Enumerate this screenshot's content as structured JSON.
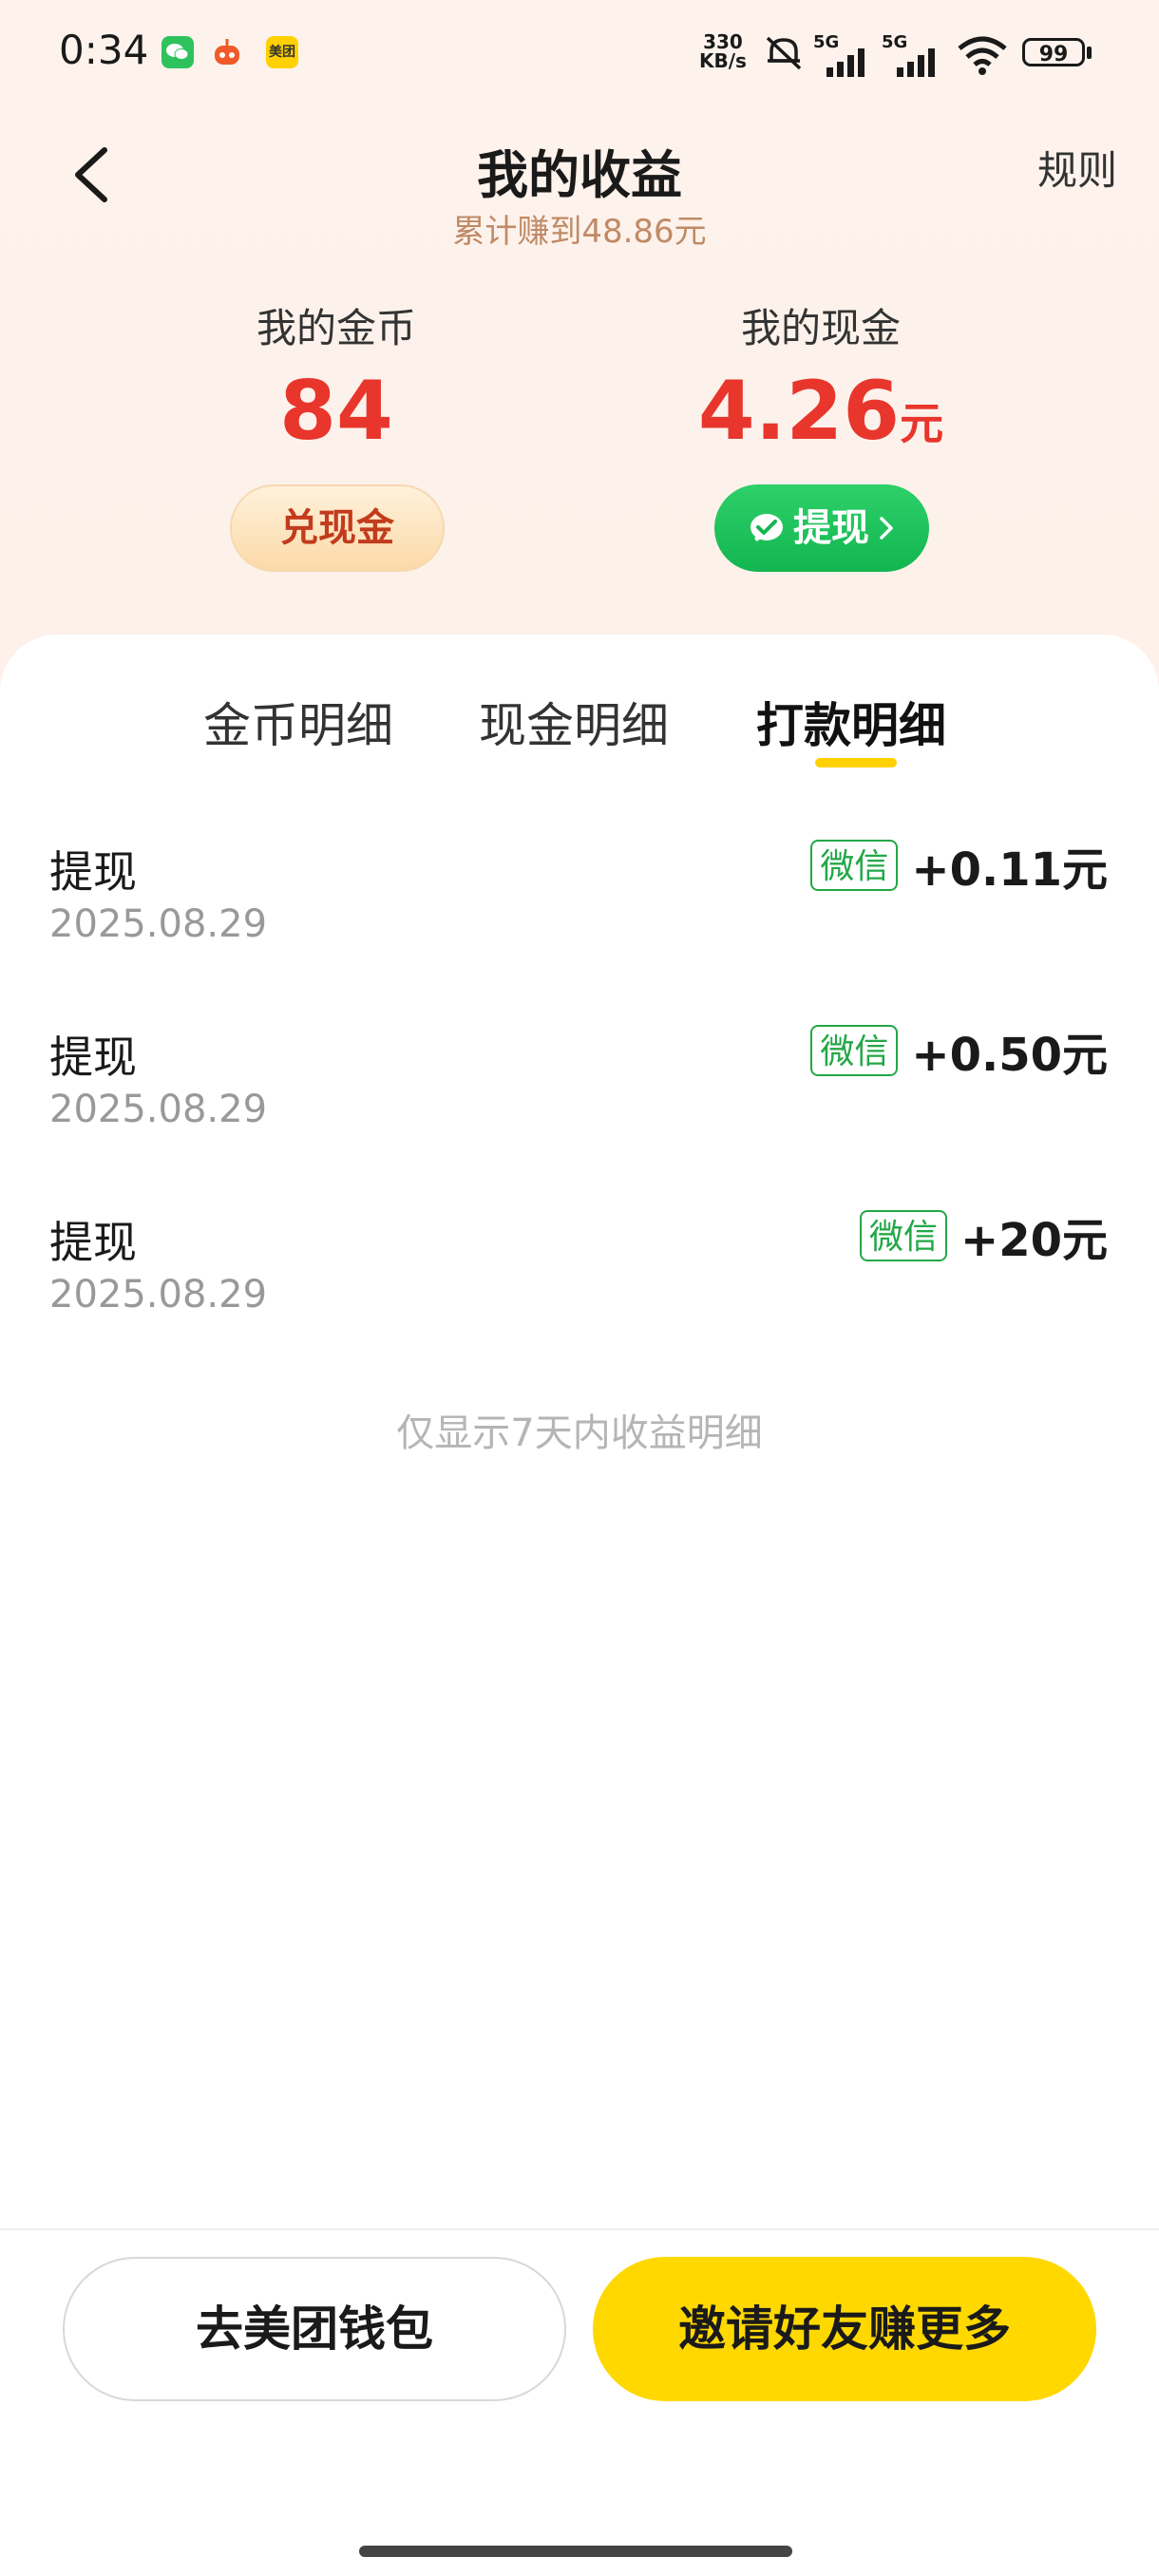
{
  "status_bar": {
    "time": "0:34",
    "mini_app_label": "美团",
    "net_speed_top": "330",
    "net_speed_bottom": "KB/s",
    "signal_1": "5G",
    "signal_2": "5G",
    "battery": "99"
  },
  "header": {
    "title": "我的收益",
    "subtitle": "累计赚到48.86元",
    "rules_label": "规则"
  },
  "summary": {
    "coins_label": "我的金币",
    "coins_value": "84",
    "exchange_label": "兑现金",
    "cash_label": "我的现金",
    "cash_value": "4.26",
    "cash_unit": "元",
    "withdraw_label": "提现"
  },
  "tabs": [
    {
      "label": "金币明细",
      "active": false
    },
    {
      "label": "现金明细",
      "active": false
    },
    {
      "label": "打款明细",
      "active": true
    }
  ],
  "records": [
    {
      "type": "提现",
      "date": "2025.08.29",
      "channel": "微信",
      "amount": "+0.11元"
    },
    {
      "type": "提现",
      "date": "2025.08.29",
      "channel": "微信",
      "amount": "+0.50元"
    },
    {
      "type": "提现",
      "date": "2025.08.29",
      "channel": "微信",
      "amount": "+20元"
    }
  ],
  "footnote": "仅显示7天内收益明细",
  "bottom": {
    "wallet_label": "去美团钱包",
    "invite_label": "邀请好友赚更多"
  },
  "colors": {
    "accent_red": "#e8362d",
    "wechat_green": "#13b550",
    "brand_yellow": "#ffd800"
  }
}
